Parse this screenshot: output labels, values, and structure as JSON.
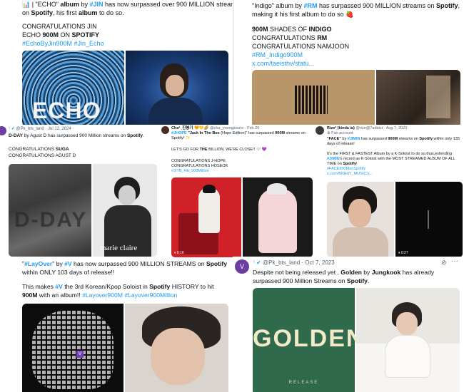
{
  "p1": {
    "line1": {
      "prefix": "📊 | \"ECHO\" ",
      "b1": "album",
      "mid": " by ",
      "tag": "#JIN",
      "rest": " has now surpassed over 900 MILLION streams"
    },
    "line2": {
      "pre": "on ",
      "b1": "Spotify",
      "mid": ", his first ",
      "b2": "album",
      "post": " to do so."
    },
    "congrats": "CONGRATULATIONS JIN",
    "echo": {
      "pre": "ECHO ",
      "b1": "900M",
      "mid": " ON ",
      "b2": "SPOTIFY"
    },
    "tags": "#EchoByJin900M #Jin_Echo",
    "img_text": "ECHO"
  },
  "p2": {
    "line1": {
      "pre": "\"Indigo\" album by ",
      "tag": "#RM",
      "mid": " has surpassed 900 MILLION streams on ",
      "b1": "Spotify",
      "post": ","
    },
    "line2": "making it his first album to do so 🍓",
    "shades": {
      "b1": "900M",
      "mid": " SHADES OF ",
      "b2": "INDIGO"
    },
    "c1": {
      "pre": "CONGRATULATIONS ",
      "b1": "RM"
    },
    "c2": "CONGRATULATIONS NAMJOON",
    "tag": "#RM_Indigo900M",
    "link": "x.com/taeisthv/statu..."
  },
  "p3": {
    "handle": "@Pk_bts_land",
    "date": "Jul 12, 2024",
    "text": {
      "b1": "D-DAY",
      "mid": " by Agust D has surpassed 900 Million streams on ",
      "b2": "Spotify",
      "post": "."
    },
    "c1": {
      "pre": "CONGRATULATIONS ",
      "b1": "SUGA"
    },
    "c2": "CONGRATULATIONS AGUST D",
    "img_text": "D-DAY",
    "mag": "marie claire"
  },
  "p4": {
    "name": "Cha²_진봉기",
    "handle": "@cha_yoongjiuune · Feb 26",
    "line1": {
      "tag": "#JHOPE",
      "b1": " \"Jack In The Box",
      "mid": " (Hope Edition)\" has surpassed ",
      "b2": "900M",
      "post": " streams on"
    },
    "line2": "Spotify! ✨",
    "line3": {
      "pre": "LET'S GO FOR ",
      "b1": "THE",
      "post": " BILLION, WE'RE CLOSE!! 🤍 💜"
    },
    "c1": "CONGRATULATIONS J-HOPE",
    "c2": "CONGRATULATIONS HOSEOK",
    "tag": "#JITB_HE_900Million",
    "time": "0:16"
  },
  "p5": {
    "name": "Rize² (kinda ia)",
    "handle": "@rize@7addict · Aug 7, 2023",
    "acct": "Fan account",
    "l1": {
      "b1": "\"FACE\"",
      "mid": " by ",
      "tag": "#JIMIN",
      "rest": " has surpassed ",
      "b2": "900M",
      "rest2": " streams on ",
      "b3": "Spotify",
      "post": " within only 135"
    },
    "l2": "days of release!",
    "l3": "It's the FIRST & FASTEST Album by a K-Soloist to do so,thus,extending",
    "l4": {
      "tag": "#JIMIN",
      "mid": "'s record as K-Soloist with the MOST STREAMED ALBUM OF ALL"
    },
    "l5": {
      "pre": "TIME on ",
      "b1": "Spotify",
      "post": "!"
    },
    "tag": "#FACE900MonSpotify",
    "link": "x.com/BIGHIT_MUSIC/s...",
    "time": "0:27"
  },
  "p6": {
    "line1": {
      "pre": "\"",
      "tag": "#LayOver",
      "mid": "\" by ",
      "tag2": "#V",
      "rest": " has now surpassed 900 MILLION STREAMS on ",
      "b1": "Spotify"
    },
    "line2": "within ONLY 103 days of release!!",
    "line3": {
      "pre": "This makes ",
      "tag": "#V",
      "mid": " the 3rd Korean/Kpop Soloist in ",
      "b1": "Spotify",
      "post": " HISTORY to hit"
    },
    "line4": {
      "b1": "900M",
      "mid": " with an album!! ",
      "tags": "#Layover900M #Layover900Million"
    }
  },
  "p7": {
    "handle": "@Pk_bts_land",
    "date": "Oct 7, 2023",
    "line1": {
      "pre": "Despite not being released yet , ",
      "b1": "Golden",
      "mid": " by ",
      "b2": "Jungkook",
      "post": " has already"
    },
    "line2": {
      "pre": "surpassed 900 Million Streams on ",
      "b1": "Spotify",
      "post": "."
    },
    "golden": "GOLDEN",
    "release": "RELEASE"
  }
}
